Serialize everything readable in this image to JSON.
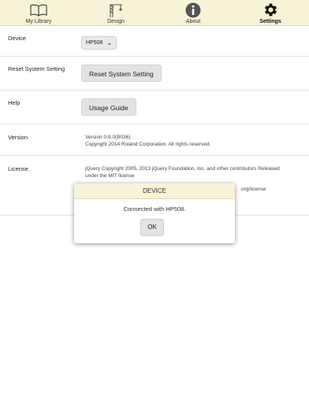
{
  "tabs": [
    {
      "label": "My Library",
      "icon": "book-icon",
      "active": false
    },
    {
      "label": "Design",
      "icon": "crane-icon",
      "active": false
    },
    {
      "label": "About",
      "icon": "info-icon",
      "active": false
    },
    {
      "label": "Settings",
      "icon": "gear-icon",
      "active": true
    }
  ],
  "settings": {
    "device": {
      "label": "Device",
      "selected": "HP508"
    },
    "reset": {
      "label": "Reset System Setting",
      "button": "Reset System Setting"
    },
    "help": {
      "label": "Help",
      "button": "Usage Guide"
    },
    "version": {
      "label": "Version",
      "line1": "Version 0.9.0(B036)",
      "line2": "Copyright 2014 Roland Corporation. All rights reserved."
    },
    "license": {
      "label": "License",
      "line1": "jQuery Copyright 2005, 2013 jQuery Foundation, Inc. and other contributors Released",
      "line2": "under the MIT license",
      "line3_partial": "org/license"
    }
  },
  "dialog": {
    "title": "DEVICE",
    "message": "Connected with HP508.",
    "ok": "OK"
  },
  "colors": {
    "header_bg": "#f7f3d6",
    "button_bg": "#e3e3e3"
  }
}
